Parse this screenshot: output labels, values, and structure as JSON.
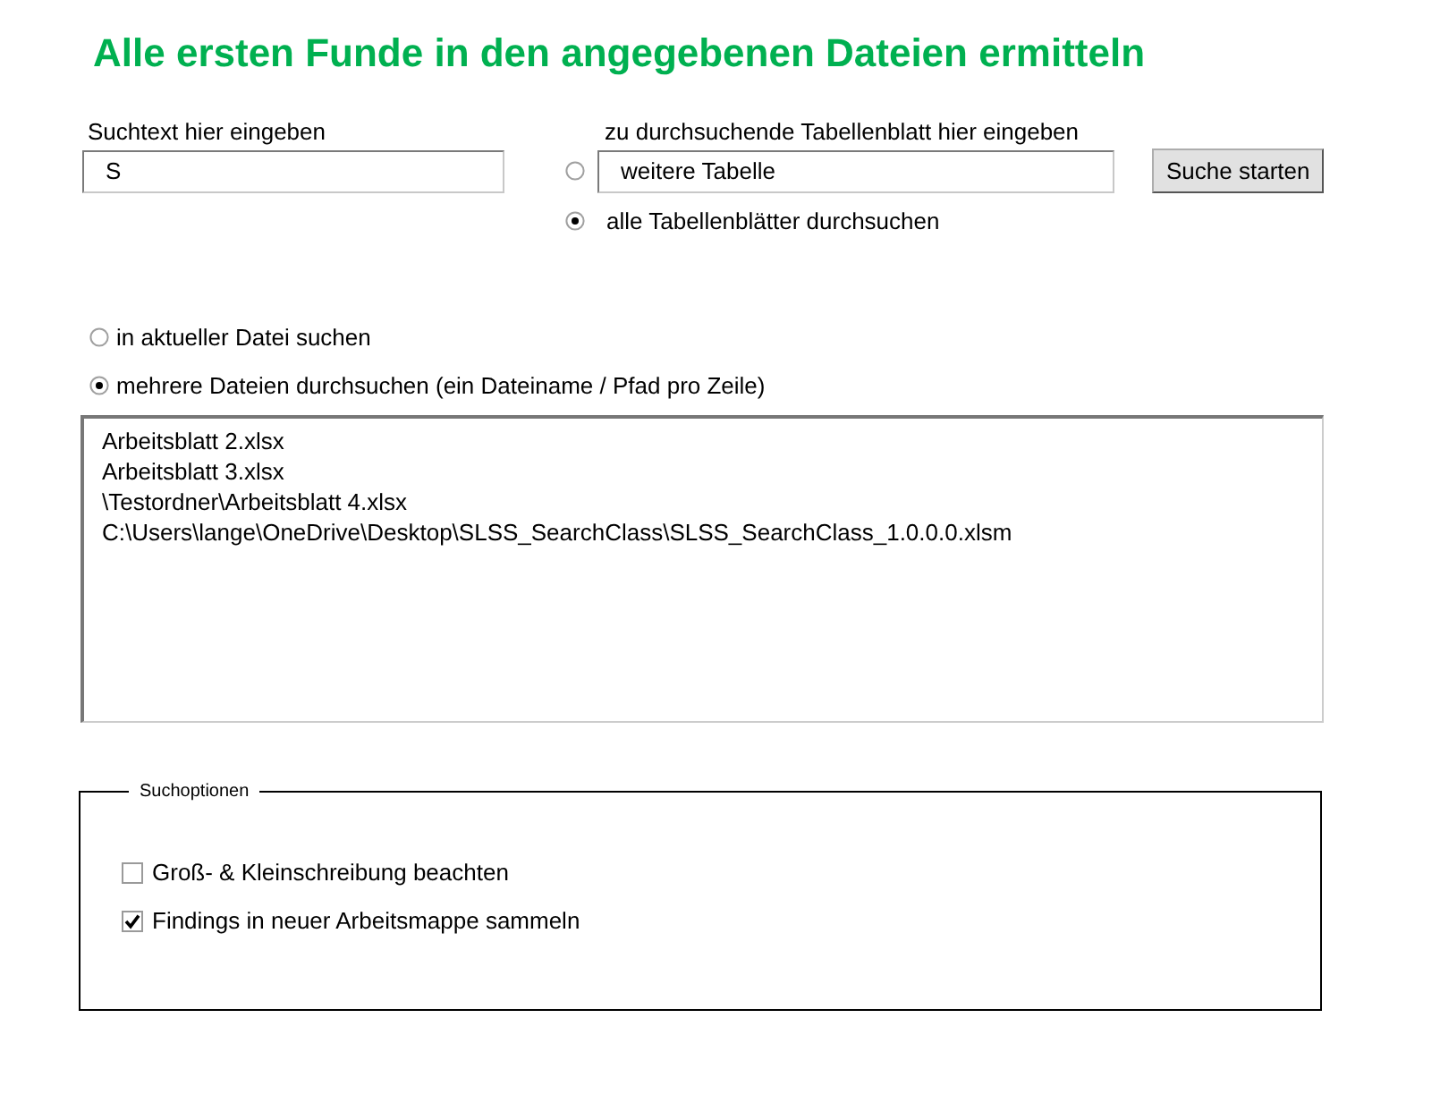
{
  "title": "Alle ersten Funde in den angegebenen Dateien ermitteln",
  "search": {
    "label": "Suchtext hier eingeben",
    "value": "S"
  },
  "sheet": {
    "label": "zu durchsuchende Tabellenblatt hier eingeben",
    "options": [
      {
        "kind": "field",
        "value": "weitere Tabelle",
        "selected": false
      },
      {
        "kind": "label",
        "label": "alle Tabellenblätter durchsuchen",
        "selected": true
      }
    ]
  },
  "start_button": "Suche starten",
  "scope": [
    {
      "label": "in aktueller Datei suchen",
      "selected": false
    },
    {
      "label": "mehrere Dateien durchsuchen (ein Dateiname / Pfad pro Zeile)",
      "selected": true
    }
  ],
  "files": [
    "Arbeitsblatt 2.xlsx",
    "Arbeitsblatt 3.xlsx",
    "\\Testordner\\Arbeitsblatt 4.xlsx",
    "C:\\Users\\lange\\OneDrive\\Desktop\\SLSS_SearchClass\\SLSS_SearchClass_1.0.0.0.xlsm"
  ],
  "options": {
    "title": "Suchoptionen",
    "items": [
      {
        "label": "Groß- & Kleinschreibung beachten",
        "checked": false
      },
      {
        "label": "Findings in neuer Arbeitsmappe sammeln",
        "checked": true
      }
    ]
  }
}
